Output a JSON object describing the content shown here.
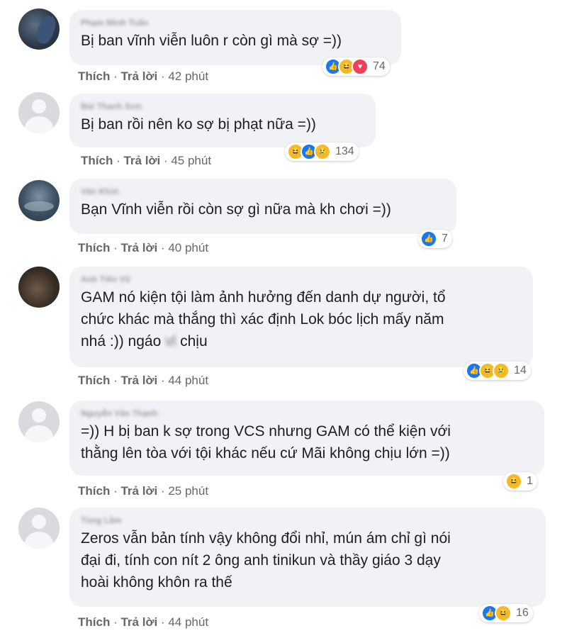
{
  "comments": [
    {
      "author": "Phạm Minh Tuấn",
      "text": "Bị ban vĩnh viễn luôn r còn gì mà sợ =))",
      "reactions": [
        "like-icon",
        "haha-icon",
        "love-icon"
      ],
      "reaction_count": "74",
      "like": "Thích",
      "reply": "Trả lời",
      "time": "42 phút"
    },
    {
      "author": "Bùi Thanh Sơn",
      "text": "Bị ban rồi nên ko sợ bị phạt nữa =))",
      "reactions": [
        "haha-icon",
        "like-icon",
        "sad-icon"
      ],
      "reaction_count": "134",
      "like": "Thích",
      "reply": "Trả lời",
      "time": "45 phút"
    },
    {
      "author": "Văn Khởi",
      "text": "Bạn Vĩnh viễn rồi còn sợ gì nữa mà kh chơi =))",
      "reactions": [
        "like-icon"
      ],
      "reaction_count": "7",
      "like": "Thích",
      "reply": "Trả lời",
      "time": "40 phút"
    },
    {
      "author": "Anh Tiến Vũ",
      "text_line1": "GAM nó kiện tội làm ảnh hưởng đến danh dự người, tổ",
      "text_line2": "chức khác mà thắng thì xác định Lok bóc lịch mấy năm",
      "text_line3_pre": "nhá :)) ngáo",
      "text_line3_blur": "vl",
      "text_line3_post": "chịu",
      "reactions": [
        "like-icon",
        "haha-icon",
        "sad-icon"
      ],
      "reaction_count": "14",
      "like": "Thích",
      "reply": "Trả lời",
      "time": "44 phút"
    },
    {
      "author": "Nguyễn Văn Thạnh",
      "text_line1": "=)) H bị ban k sợ trong VCS nhưng GAM có thể kiện với",
      "text_line2": "thằng lên tòa với tội khác nếu cứ Mãi không chịu lớn =))",
      "reactions": [
        "haha-icon"
      ],
      "reaction_count": "1",
      "like": "Thích",
      "reply": "Trả lời",
      "time": "25 phút"
    },
    {
      "author": "Tùng Lâm",
      "text_line1": "Zeros vẫn bản tính vậy không đổi nhỉ, mún ám chỉ gì nói",
      "text_line2": "đại đi, tính con nít 2 ông anh tinikun và thầy giáo 3 dạy",
      "text_line3": "hoài không khôn ra thế",
      "reactions": [
        "like-icon",
        "haha-icon"
      ],
      "reaction_count": "16",
      "like": "Thích",
      "reply": "Trả lời",
      "time": "44 phút"
    }
  ]
}
